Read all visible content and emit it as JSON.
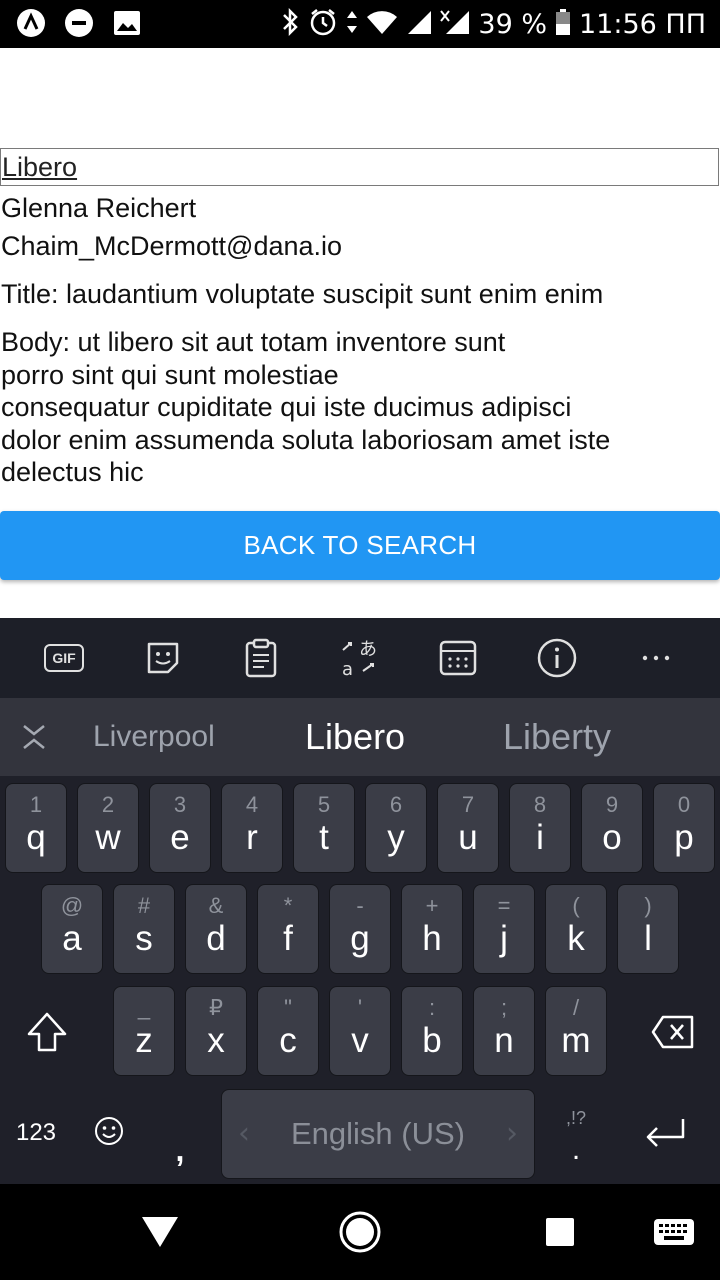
{
  "status_bar": {
    "battery": "39 %",
    "time": "11:56 ПП"
  },
  "search": {
    "value": "Libero"
  },
  "result": {
    "name": "Glenna Reichert",
    "email": "Chaim_McDermott@dana.io",
    "title": "Title: laudantium voluptate suscipit sunt enim enim",
    "body": "Body: ut libero sit aut totam inventore sunt\nporro sint qui sunt molestiae\nconsequatur cupiditate qui iste ducimus adipisci\ndolor enim assumenda soluta laboriosam amet iste\ndelectus hic"
  },
  "back_button": {
    "label": "BACK TO SEARCH",
    "color": "#2196f3"
  },
  "keyboard": {
    "toolbar": {
      "gif_label": "GIF",
      "icons": [
        "gif-icon",
        "sticker-icon",
        "clipboard-icon",
        "translate-icon",
        "calendar-icon",
        "info-icon",
        "more-icon"
      ]
    },
    "suggestions": [
      "Liverpool",
      "Libero",
      "Liberty"
    ],
    "row1": [
      {
        "num": "1",
        "ch": "q"
      },
      {
        "num": "2",
        "ch": "w"
      },
      {
        "num": "3",
        "ch": "e"
      },
      {
        "num": "4",
        "ch": "r"
      },
      {
        "num": "5",
        "ch": "t"
      },
      {
        "num": "6",
        "ch": "y"
      },
      {
        "num": "7",
        "ch": "u"
      },
      {
        "num": "8",
        "ch": "i"
      },
      {
        "num": "9",
        "ch": "o"
      },
      {
        "num": "0",
        "ch": "p"
      }
    ],
    "row2": [
      {
        "num": "@",
        "ch": "a"
      },
      {
        "num": "#",
        "ch": "s"
      },
      {
        "num": "&",
        "ch": "d"
      },
      {
        "num": "*",
        "ch": "f"
      },
      {
        "num": "-",
        "ch": "g"
      },
      {
        "num": "+",
        "ch": "h"
      },
      {
        "num": "=",
        "ch": "j"
      },
      {
        "num": "(",
        "ch": "k"
      },
      {
        "num": ")",
        "ch": "l"
      }
    ],
    "row3": [
      {
        "num": "_",
        "ch": "z"
      },
      {
        "num": "₽",
        "ch": "x"
      },
      {
        "num": "\"",
        "ch": "c"
      },
      {
        "num": "'",
        "ch": "v"
      },
      {
        "num": ":",
        "ch": "b"
      },
      {
        "num": ";",
        "ch": "n"
      },
      {
        "num": "/",
        "ch": "m"
      }
    ],
    "numbers_key": "123",
    "comma": ",",
    "space_language": "English (US)",
    "period_hint": ",!?",
    "period": "."
  }
}
